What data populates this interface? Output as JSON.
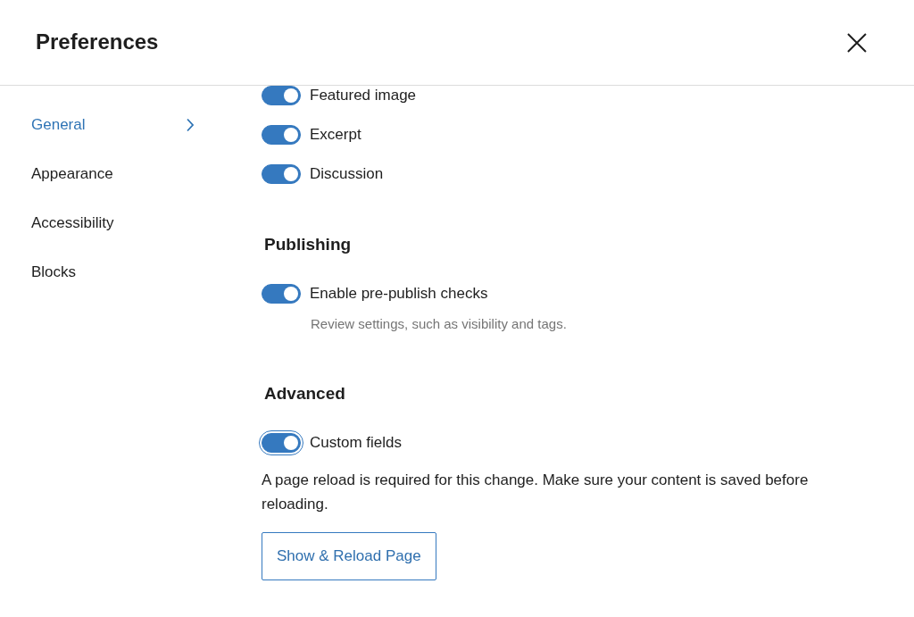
{
  "dialog": {
    "title": "Preferences"
  },
  "sidebar": {
    "items": [
      {
        "label": "General",
        "selected": true
      },
      {
        "label": "Appearance",
        "selected": false
      },
      {
        "label": "Accessibility",
        "selected": false
      },
      {
        "label": "Blocks",
        "selected": false
      }
    ]
  },
  "sections": [
    {
      "options": [
        {
          "label": "Featured image",
          "on": true,
          "focused": false
        },
        {
          "label": "Excerpt",
          "on": true,
          "focused": false
        },
        {
          "label": "Discussion",
          "on": true,
          "focused": false
        }
      ]
    },
    {
      "heading": "Publishing",
      "options": [
        {
          "label": "Enable pre-publish checks",
          "on": true,
          "focused": false,
          "help": "Review settings, such as visibility and tags."
        }
      ]
    },
    {
      "heading": "Advanced",
      "options": [
        {
          "label": "Custom fields",
          "on": true,
          "focused": true
        }
      ],
      "notice": "A page reload is required for this change. Make sure your content is saved before reloading.",
      "button": "Show & Reload Page"
    }
  ]
}
